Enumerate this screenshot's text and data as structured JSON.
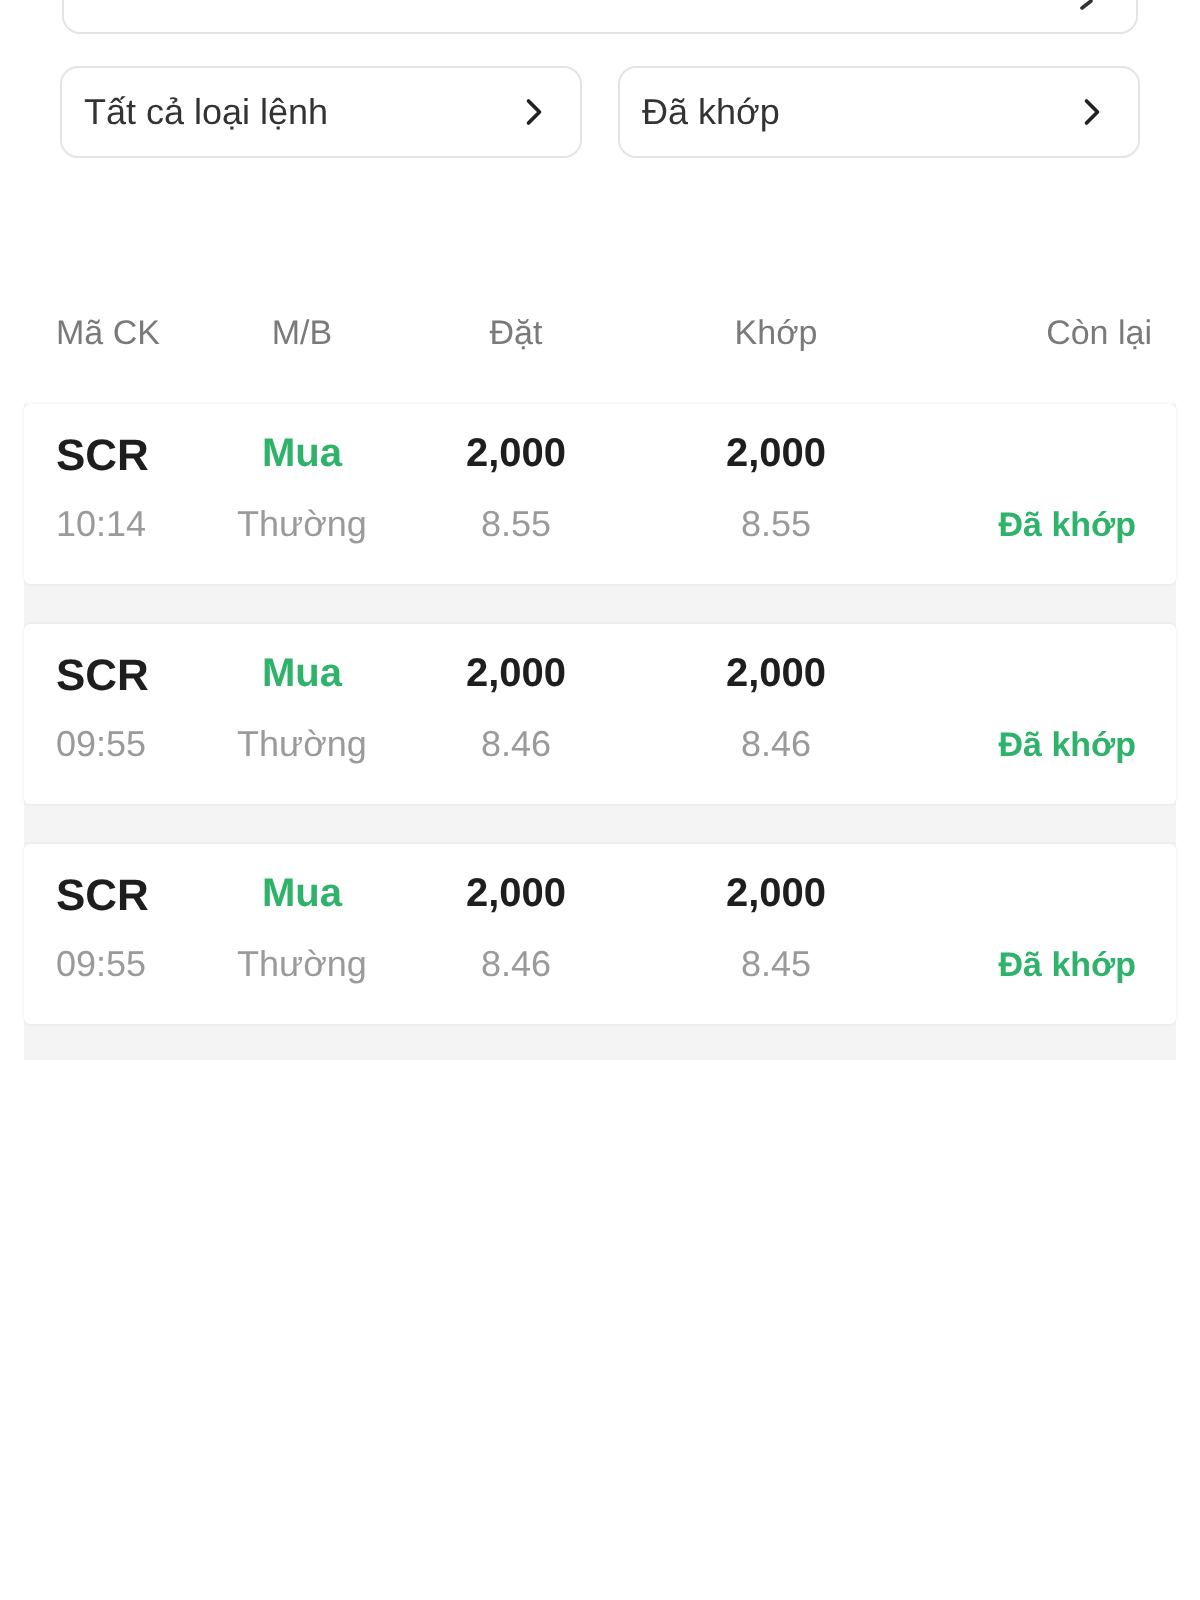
{
  "filters": [
    {
      "label": "Tất cả loại lệnh"
    },
    {
      "label": "Đã khớp"
    }
  ],
  "columns": [
    "Mã CK",
    "M/B",
    "Đặt",
    "Khớp",
    "Còn lại"
  ],
  "orders": [
    {
      "symbol": "SCR",
      "time": "10:14",
      "side": "Mua",
      "order_type": "Thường",
      "order_qty": "2,000",
      "order_price": "8.55",
      "matched_qty": "2,000",
      "matched_price": "8.55",
      "status": "Đã khớp"
    },
    {
      "symbol": "SCR",
      "time": "09:55",
      "side": "Mua",
      "order_type": "Thường",
      "order_qty": "2,000",
      "order_price": "8.46",
      "matched_qty": "2,000",
      "matched_price": "8.46",
      "status": "Đã khớp"
    },
    {
      "symbol": "SCR",
      "time": "09:55",
      "side": "Mua",
      "order_type": "Thường",
      "order_qty": "2,000",
      "order_price": "8.46",
      "matched_qty": "2,000",
      "matched_price": "8.45",
      "status": "Đã khớp"
    }
  ]
}
